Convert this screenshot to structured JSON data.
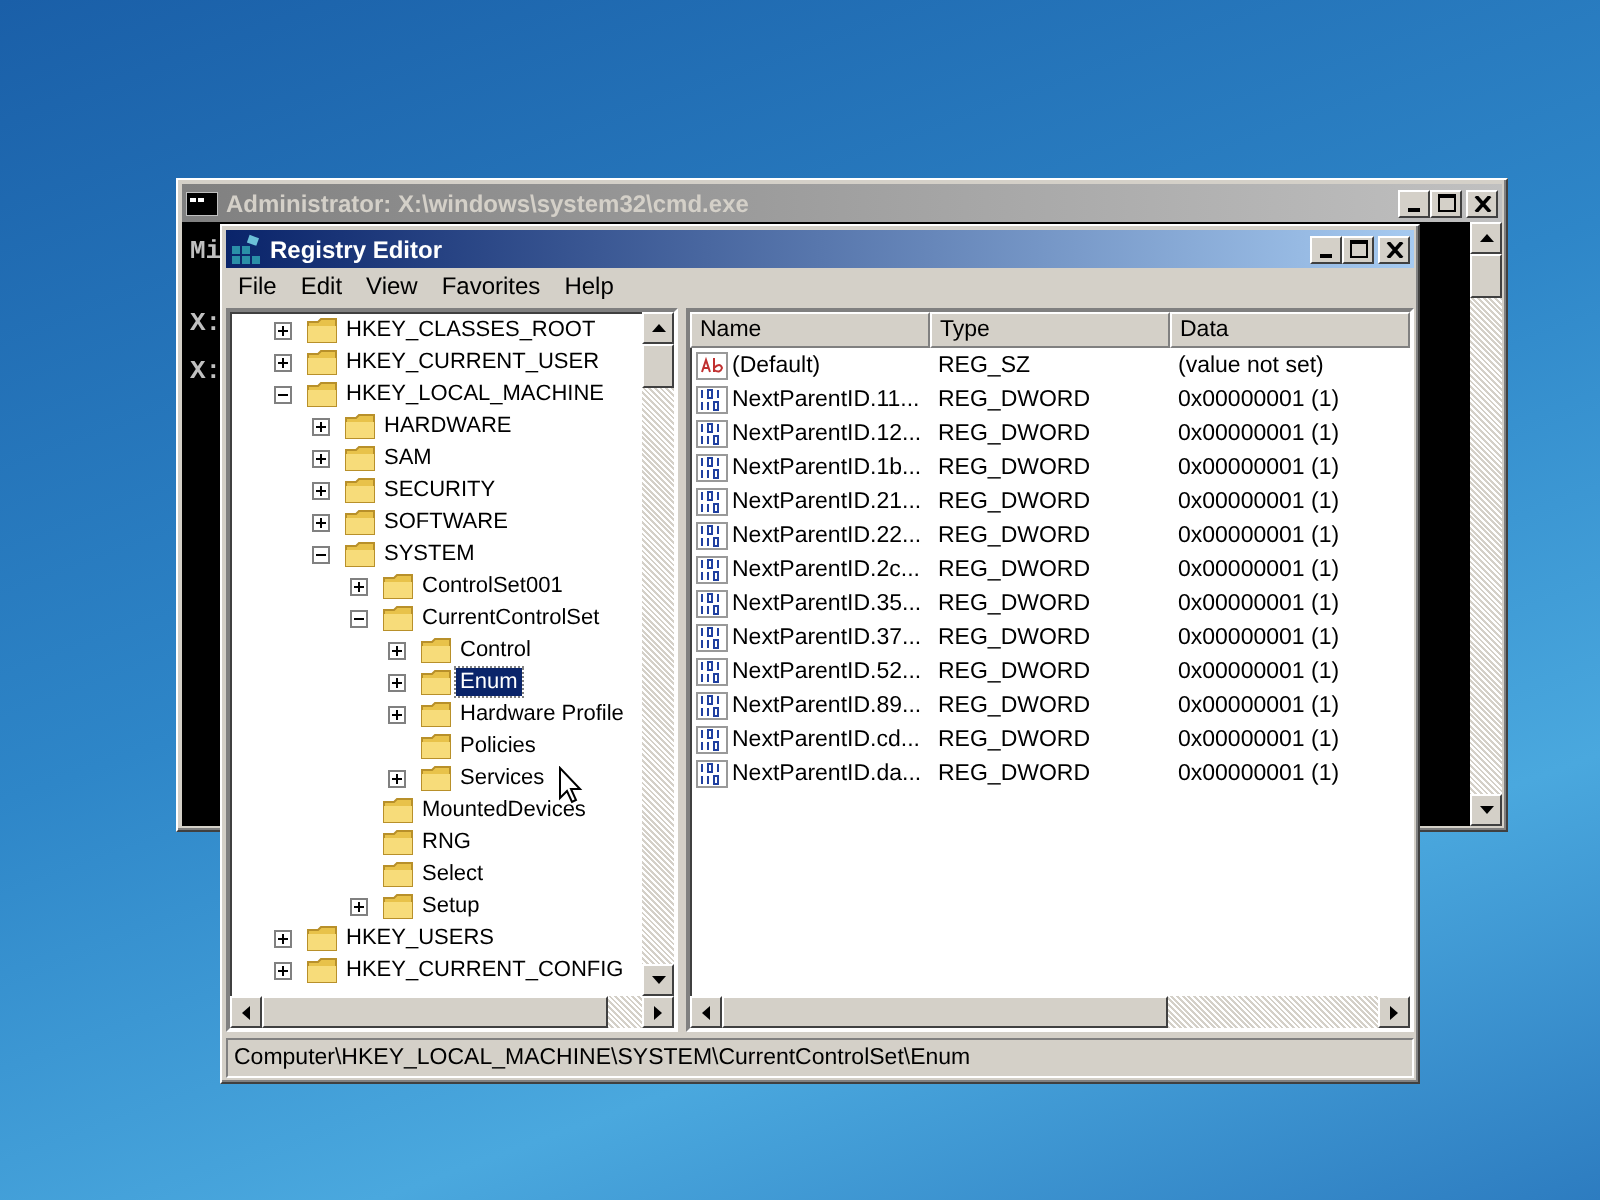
{
  "console_window": {
    "title": "Administrator: X:\\windows\\system32\\cmd.exe",
    "active": false,
    "lines": [
      "Mi",
      "X:",
      "X:"
    ]
  },
  "registry_editor": {
    "title": "Registry Editor",
    "active": true,
    "menu": [
      "File",
      "Edit",
      "View",
      "Favorites",
      "Help"
    ],
    "tree": [
      {
        "label": "HKEY_CLASSES_ROOT",
        "expanded": false,
        "selected": false
      },
      {
        "label": "HKEY_CURRENT_USER",
        "expanded": false,
        "selected": false
      },
      {
        "label": "HKEY_LOCAL_MACHINE",
        "expanded": true,
        "selected": false,
        "children": [
          {
            "label": "HARDWARE",
            "expanded": false,
            "selected": false
          },
          {
            "label": "SAM",
            "expanded": false,
            "selected": false
          },
          {
            "label": "SECURITY",
            "expanded": false,
            "selected": false
          },
          {
            "label": "SOFTWARE",
            "expanded": false,
            "selected": false
          },
          {
            "label": "SYSTEM",
            "expanded": true,
            "selected": false,
            "children": [
              {
                "label": "ControlSet001",
                "expanded": false,
                "selected": false
              },
              {
                "label": "CurrentControlSet",
                "expanded": true,
                "selected": false,
                "children": [
                  {
                    "label": "Control",
                    "expanded": false,
                    "selected": false
                  },
                  {
                    "label": "Enum",
                    "expanded": false,
                    "selected": true
                  },
                  {
                    "label": "Hardware Profile",
                    "expanded": false,
                    "selected": false
                  },
                  {
                    "label": "Policies",
                    "selected": false
                  },
                  {
                    "label": "Services",
                    "expanded": false,
                    "selected": false
                  }
                ]
              },
              {
                "label": "MountedDevices",
                "selected": false
              },
              {
                "label": "RNG",
                "selected": false
              },
              {
                "label": "Select",
                "selected": false
              },
              {
                "label": "Setup",
                "expanded": false,
                "selected": false
              }
            ]
          }
        ]
      },
      {
        "label": "HKEY_USERS",
        "expanded": false,
        "selected": false
      },
      {
        "label": "HKEY_CURRENT_CONFIG",
        "expanded": false,
        "selected": false
      }
    ],
    "columns": [
      "Name",
      "Type",
      "Data"
    ],
    "values": [
      {
        "kind": "string",
        "name": "(Default)",
        "type": "REG_SZ",
        "data": "(value not set)"
      },
      {
        "kind": "dword",
        "name": "NextParentID.11...",
        "type": "REG_DWORD",
        "data": "0x00000001 (1)"
      },
      {
        "kind": "dword",
        "name": "NextParentID.12...",
        "type": "REG_DWORD",
        "data": "0x00000001 (1)"
      },
      {
        "kind": "dword",
        "name": "NextParentID.1b...",
        "type": "REG_DWORD",
        "data": "0x00000001 (1)"
      },
      {
        "kind": "dword",
        "name": "NextParentID.21...",
        "type": "REG_DWORD",
        "data": "0x00000001 (1)"
      },
      {
        "kind": "dword",
        "name": "NextParentID.22...",
        "type": "REG_DWORD",
        "data": "0x00000001 (1)"
      },
      {
        "kind": "dword",
        "name": "NextParentID.2c...",
        "type": "REG_DWORD",
        "data": "0x00000001 (1)"
      },
      {
        "kind": "dword",
        "name": "NextParentID.35...",
        "type": "REG_DWORD",
        "data": "0x00000001 (1)"
      },
      {
        "kind": "dword",
        "name": "NextParentID.37...",
        "type": "REG_DWORD",
        "data": "0x00000001 (1)"
      },
      {
        "kind": "dword",
        "name": "NextParentID.52...",
        "type": "REG_DWORD",
        "data": "0x00000001 (1)"
      },
      {
        "kind": "dword",
        "name": "NextParentID.89...",
        "type": "REG_DWORD",
        "data": "0x00000001 (1)"
      },
      {
        "kind": "dword",
        "name": "NextParentID.cd...",
        "type": "REG_DWORD",
        "data": "0x00000001 (1)"
      },
      {
        "kind": "dword",
        "name": "NextParentID.da...",
        "type": "REG_DWORD",
        "data": "0x00000001 (1)"
      }
    ],
    "status_bar": "Computer\\HKEY_LOCAL_MACHINE\\SYSTEM\\CurrentControlSet\\Enum"
  }
}
